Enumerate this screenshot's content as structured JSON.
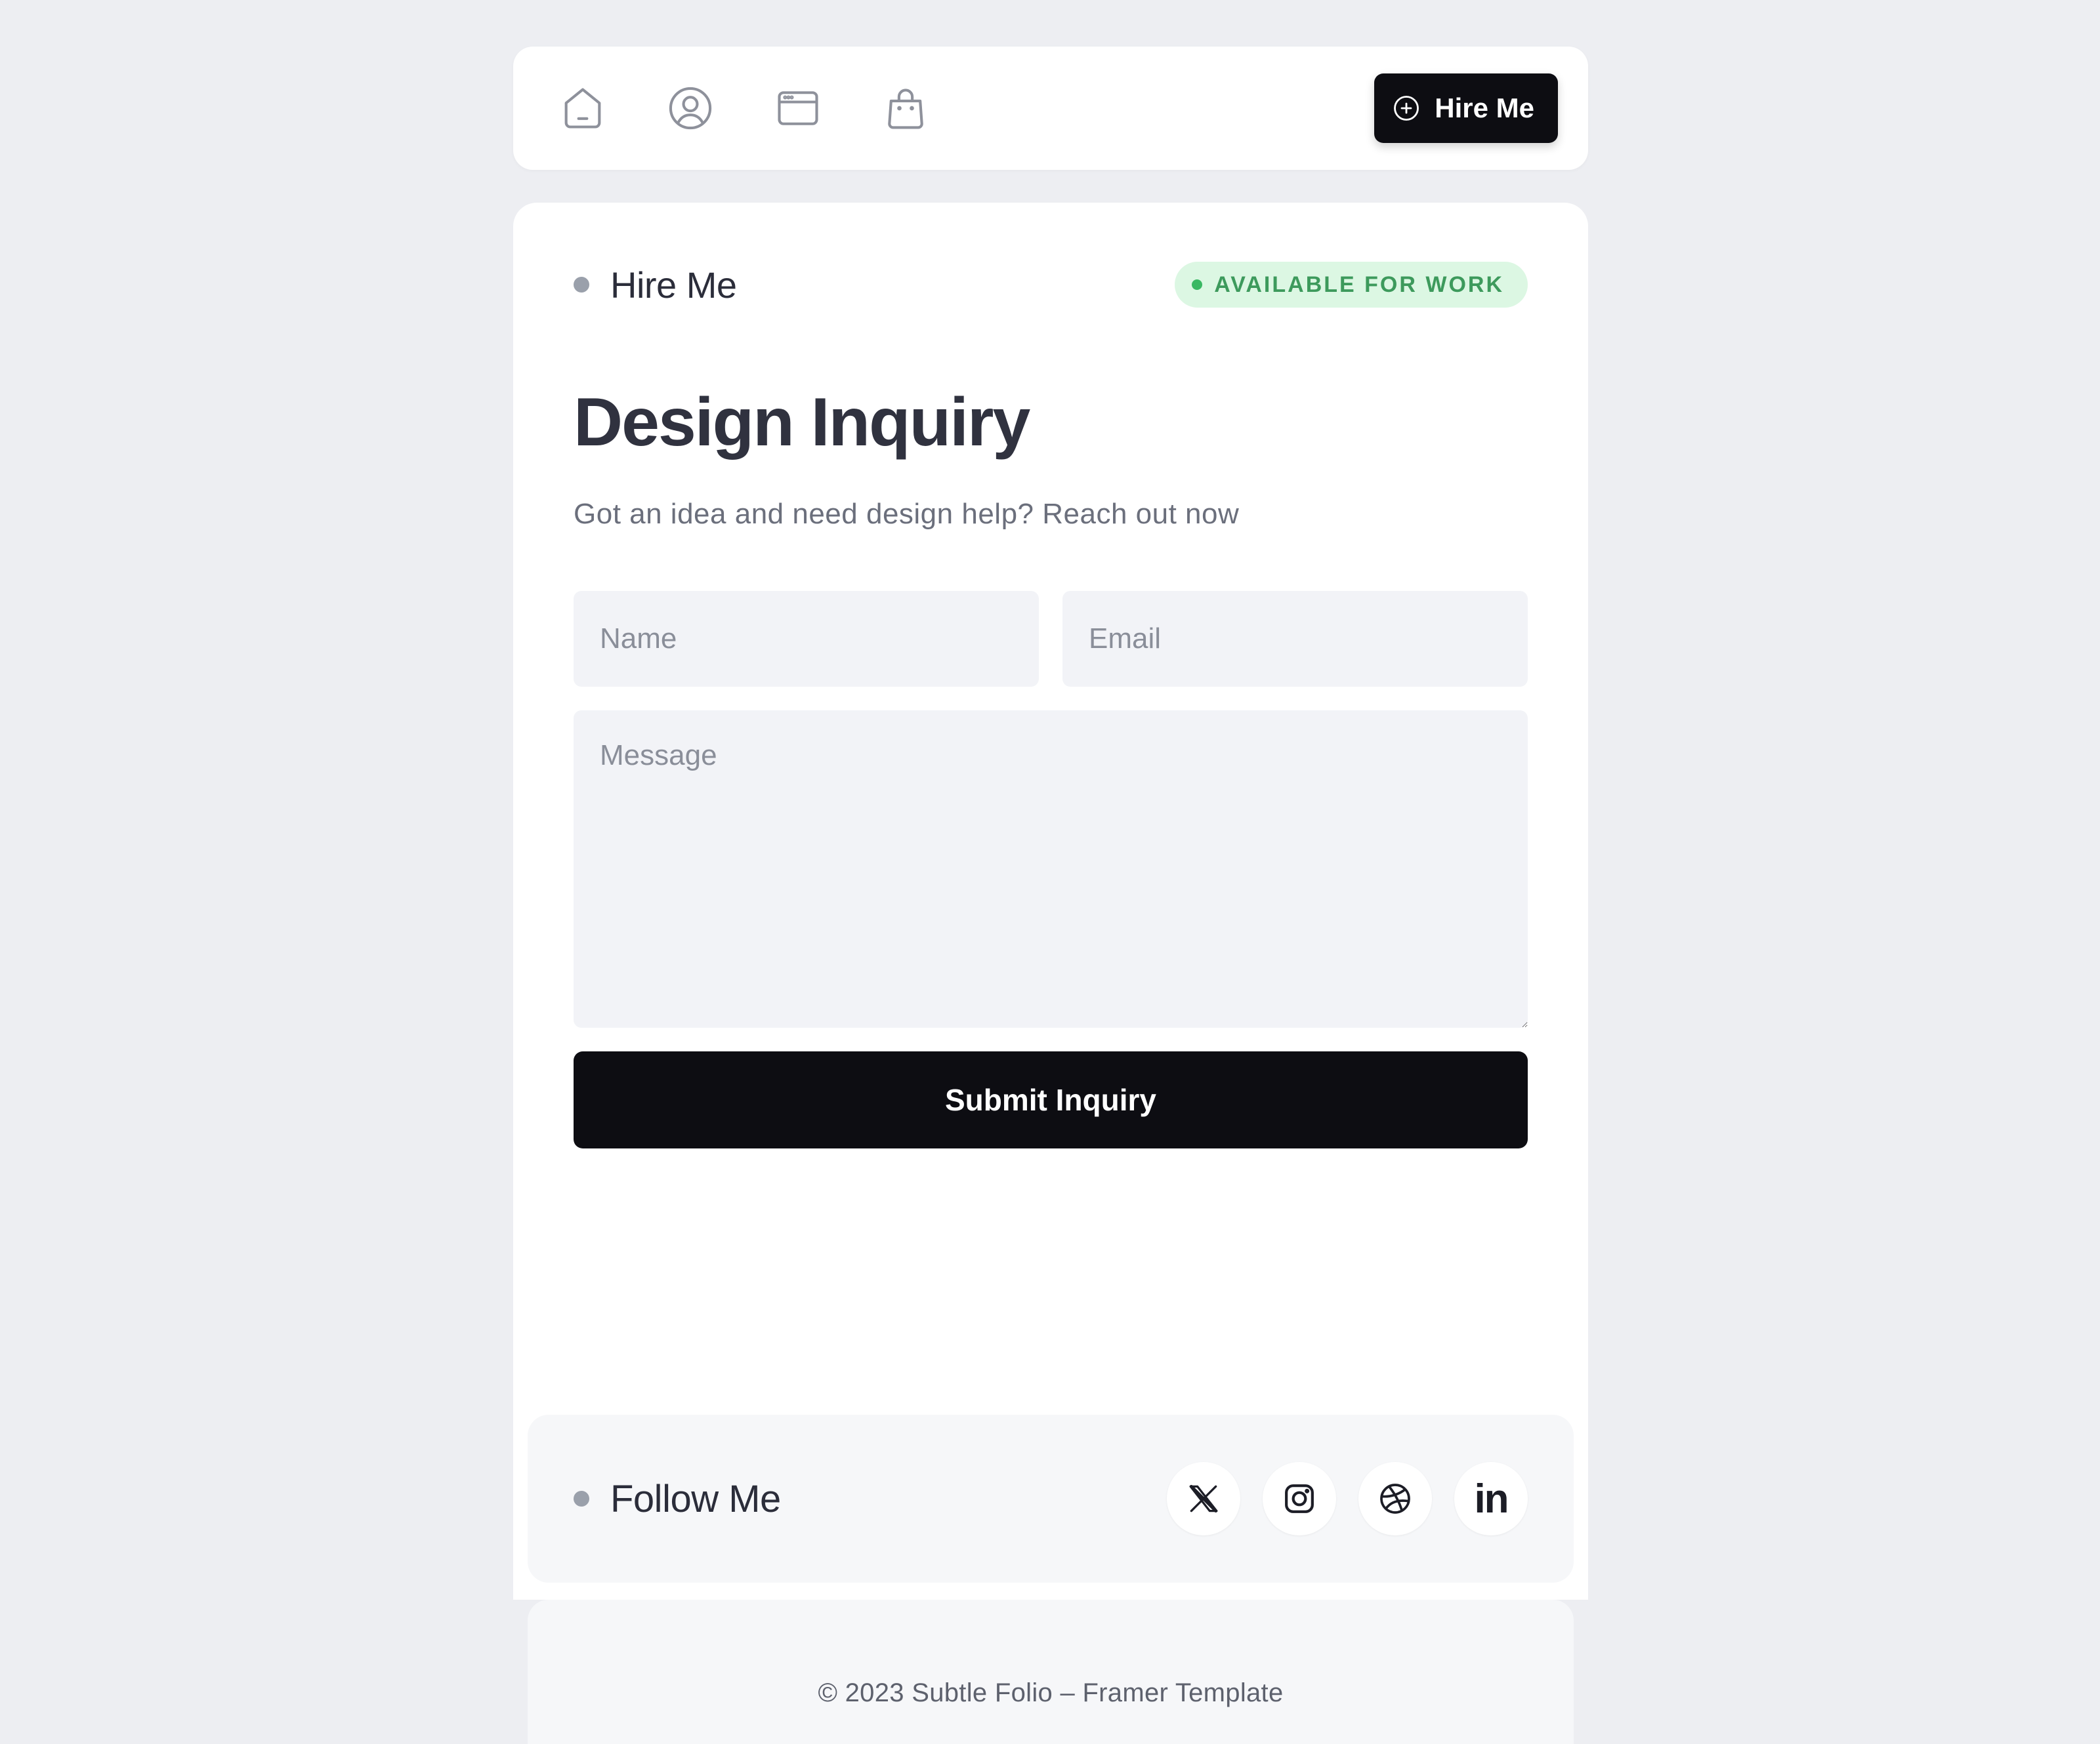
{
  "nav": {
    "icons": [
      "home-icon",
      "profile-icon",
      "browser-window-icon",
      "shopping-bag-icon"
    ],
    "hire_label": "Hire Me"
  },
  "card": {
    "section_label": "Hire Me",
    "badge": "AVAILABLE FOR WORK",
    "title": "Design Inquiry",
    "subtitle": "Got an idea and need design help? Reach out now",
    "form": {
      "name_placeholder": "Name",
      "email_placeholder": "Email",
      "message_placeholder": "Message",
      "submit_label": "Submit Inquiry"
    }
  },
  "follow": {
    "label": "Follow Me",
    "socials": [
      "x-icon",
      "instagram-icon",
      "dribbble-icon",
      "linkedin-icon"
    ],
    "linkedin_text": "in"
  },
  "footer": {
    "copyright": "© 2023 Subtle Folio – Framer Template"
  },
  "colors": {
    "page_bg": "#edeef2",
    "card_bg": "#ffffff",
    "dark": "#0d0d12",
    "badge_bg": "#dcf7e3",
    "badge_text": "#3d9a5c",
    "input_bg": "#f2f3f7"
  }
}
